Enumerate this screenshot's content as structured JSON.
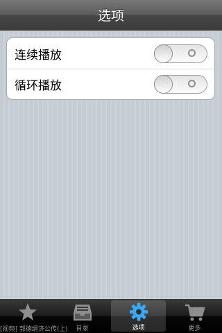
{
  "navbar": {
    "title": "选项"
  },
  "settings": {
    "items": [
      {
        "label": "连续播放",
        "enabled": false
      },
      {
        "label": "循环播放",
        "enabled": false
      }
    ]
  },
  "tabbar": {
    "tabs": [
      {
        "label": "[视频] 郭德纲济公传(上)",
        "icon": "star-icon",
        "active": false
      },
      {
        "label": "目录",
        "icon": "inbox-tray-icon",
        "active": false
      },
      {
        "label": "选项",
        "icon": "gear-icon",
        "active": true
      },
      {
        "label": "更多",
        "icon": "cart-icon",
        "active": false
      }
    ]
  },
  "colors": {
    "active_tab_icon": "#3aa8f4",
    "inactive_tab_icon": "#8e8e8e"
  }
}
